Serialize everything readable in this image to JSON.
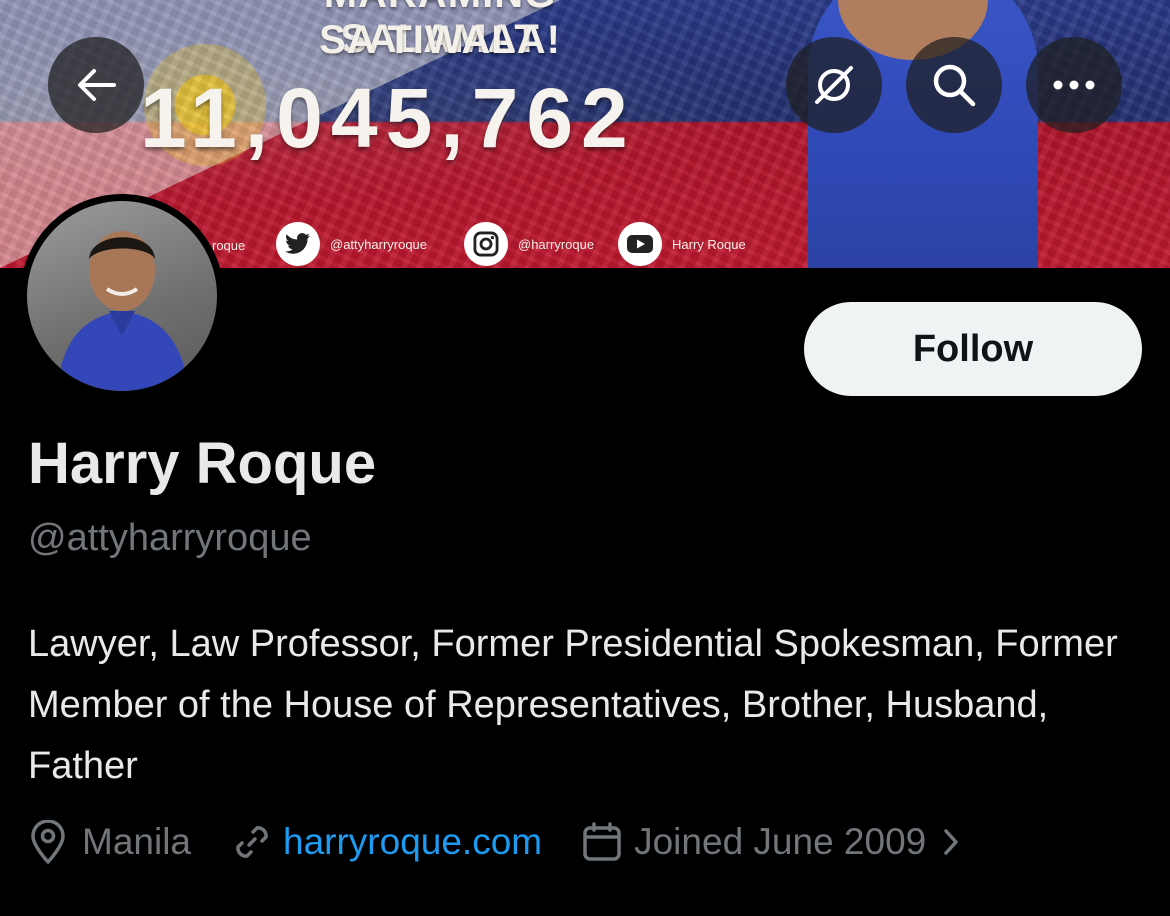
{
  "banner": {
    "headline_top": "MARAMING SALAMAT",
    "headline": "SA TIWALA!",
    "vote_count": "11,045,762",
    "partial_handle": "roque",
    "social": [
      {
        "icon": "twitter-icon",
        "label": "@attyharryroque"
      },
      {
        "icon": "instagram-icon",
        "label": "@harryroque"
      },
      {
        "icon": "youtube-icon",
        "label": "Harry Roque"
      }
    ]
  },
  "nav": {
    "back_icon": "back-arrow-icon",
    "grok_icon": "grok-icon",
    "search_icon": "search-icon",
    "more_icon": "more-icon"
  },
  "profile": {
    "follow_label": "Follow",
    "display_name": "Harry Roque",
    "handle": "@attyharryroque",
    "bio": "Lawyer, Law Professor, Former Presidential Spokesman, Former Member of the House of Representatives, Brother, Husband, Father",
    "location": "Manila",
    "website": "harryroque.com",
    "joined": "Joined June 2009"
  },
  "colors": {
    "background": "#000000",
    "text_primary": "#e7e9ea",
    "text_secondary": "#71767b",
    "link": "#1d9bf0",
    "follow_bg": "#eff3f4"
  }
}
